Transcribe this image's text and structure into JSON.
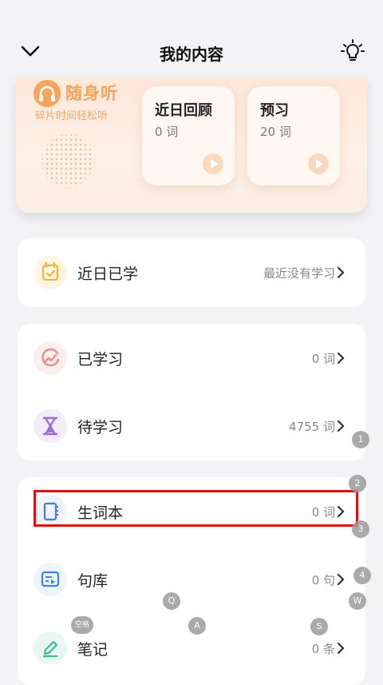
{
  "header": {
    "title": "我的内容"
  },
  "banner": {
    "brand": "随身听",
    "subtitle": "碎片时间轻松听",
    "cards": [
      {
        "title": "近日回顾",
        "count": "0 词"
      },
      {
        "title": "预习",
        "count": "20 词"
      }
    ]
  },
  "recent": {
    "label": "近日已学",
    "value": "最近没有学习"
  },
  "study": [
    {
      "label": "已学习",
      "value": "0 词"
    },
    {
      "label": "待学习",
      "value": "4755 词"
    }
  ],
  "library": [
    {
      "label": "生词本",
      "value": "0 词"
    },
    {
      "label": "句库",
      "value": "0 句"
    },
    {
      "label": "笔记",
      "value": "0 条"
    }
  ],
  "overlay_keys": {
    "k1": "1",
    "k2": "2",
    "k3": "3",
    "k4": "4",
    "q": "Q",
    "w": "W",
    "a": "A",
    "s": "S",
    "space": "空格"
  },
  "colors": {
    "accent_orange": "#f2a35c",
    "highlight_red": "#e01010",
    "icon_recent": "#f2b53a",
    "icon_learned": "#f08a8a",
    "icon_pending": "#9b6bd6",
    "icon_vocab": "#4a7be0",
    "icon_sentence": "#3a86e8",
    "icon_note": "#3dbb9b"
  }
}
